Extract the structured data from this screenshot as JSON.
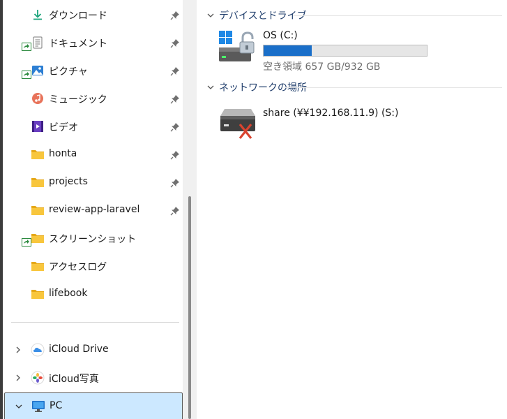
{
  "nav": {
    "items": [
      {
        "label": "ダウンロード",
        "icon": "download-icon",
        "pinned": true
      },
      {
        "label": "ドキュメント",
        "icon": "documents-icon",
        "pinned": true,
        "sync_badge": true
      },
      {
        "label": "ピクチャ",
        "icon": "pictures-icon",
        "pinned": true,
        "sync_badge": true
      },
      {
        "label": "ミュージック",
        "icon": "music-icon",
        "pinned": true
      },
      {
        "label": "ビデオ",
        "icon": "videos-icon",
        "pinned": true
      },
      {
        "label": "honta",
        "icon": "folder-icon",
        "pinned": true
      },
      {
        "label": "projects",
        "icon": "folder-icon",
        "pinned": true
      },
      {
        "label": "review-app-laravel",
        "icon": "folder-icon",
        "pinned": true
      },
      {
        "label": "スクリーンショット",
        "icon": "folder-icon",
        "pinned": false,
        "sync_badge": true
      },
      {
        "label": "アクセスログ",
        "icon": "folder-icon",
        "pinned": false
      },
      {
        "label": "lifebook",
        "icon": "folder-icon",
        "pinned": false
      }
    ],
    "tree": [
      {
        "label": "iCloud Drive",
        "icon": "icloud-drive-icon",
        "expanded": false
      },
      {
        "label": "iCloud写真",
        "icon": "icloud-photos-icon",
        "expanded": false
      },
      {
        "label": "PC",
        "icon": "pc-icon",
        "expanded": true,
        "selected": true
      }
    ]
  },
  "main": {
    "devices_header": "デバイスとドライブ",
    "drive": {
      "name": "OS (C:)",
      "free_text": "空き領域 657 GB/932 GB",
      "used_fraction": 0.295,
      "bar_color": "#1a6fc9"
    },
    "network_header": "ネットワークの場所",
    "network": {
      "name": "share (¥¥192.168.11.9) (S:)",
      "status": "disconnected"
    }
  },
  "colors": {
    "selection_bg": "#cce8ff",
    "folder": "#f8c63d",
    "header_text": "#1f3d6b"
  }
}
